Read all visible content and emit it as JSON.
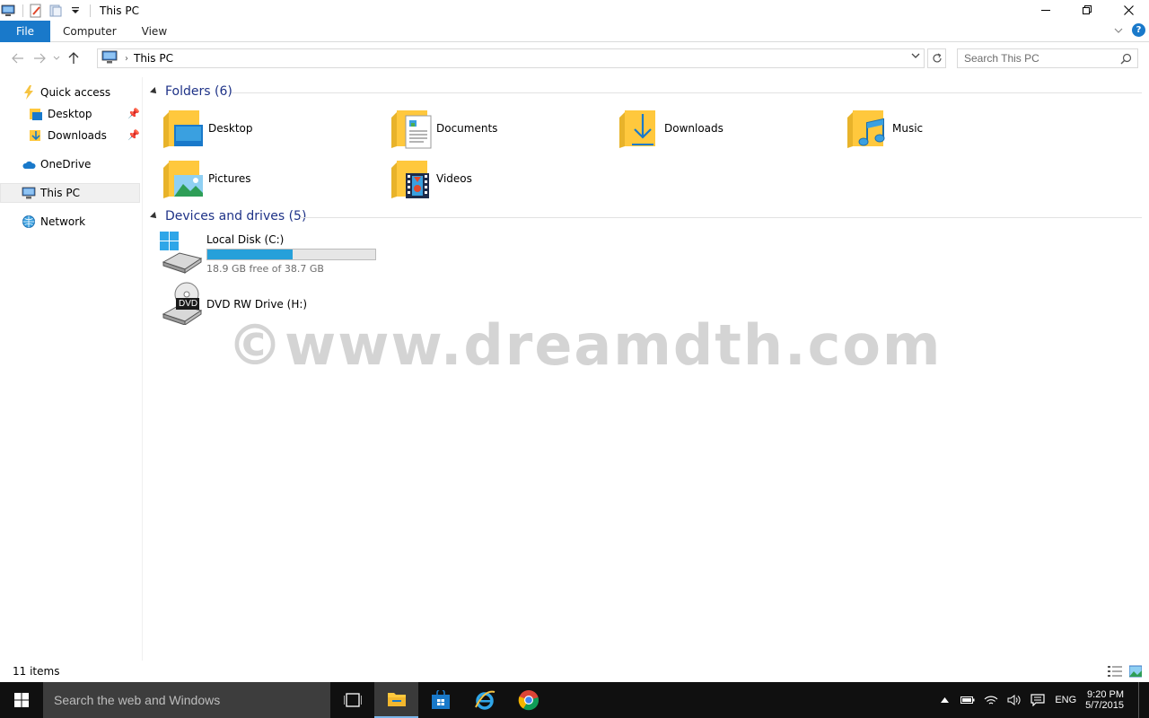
{
  "window": {
    "title": "This PC"
  },
  "ribbon": {
    "tabs": [
      "File",
      "Computer",
      "View"
    ]
  },
  "address": {
    "path": "This PC"
  },
  "search": {
    "placeholder": "Search This PC"
  },
  "navpane": {
    "quick_access": "Quick access",
    "desktop": "Desktop",
    "downloads": "Downloads",
    "onedrive": "OneDrive",
    "this_pc": "This PC",
    "network": "Network"
  },
  "folders": {
    "header": "Folders (6)",
    "items": [
      "Desktop",
      "Documents",
      "Downloads",
      "Music",
      "Pictures",
      "Videos"
    ]
  },
  "devices": {
    "header": "Devices and drives (5)",
    "local_disk": {
      "name": "Local Disk (C:)",
      "free": "18.9 GB free of 38.7 GB",
      "used_fraction": 0.51
    },
    "dvd": {
      "name": "DVD RW Drive (H:)",
      "badge": "DVD"
    }
  },
  "watermark": "©www.dreamdth.com",
  "status": {
    "items": "11 items"
  },
  "taskbar": {
    "search": "Search the web and Windows",
    "lang": "ENG",
    "time": "9:20 PM",
    "date": "5/7/2015"
  },
  "colors": {
    "accent": "#1979ca",
    "folder": "#ffc83d",
    "drive_bar": "#26a0da",
    "header_text": "#1e3287"
  }
}
